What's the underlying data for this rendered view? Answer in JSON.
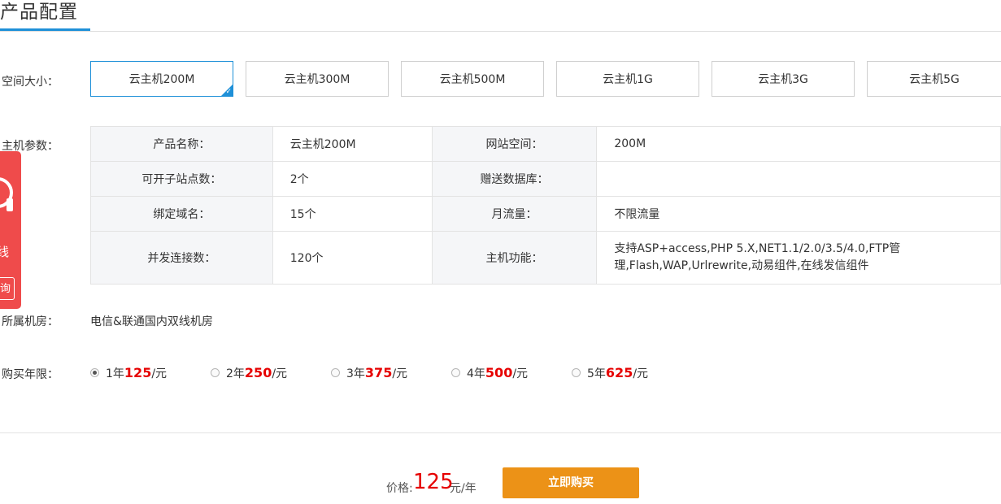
{
  "page": {
    "title": "产品配置"
  },
  "labels": {
    "space_size": "空间大小：",
    "host_params": "主机参数：",
    "room": "所属机房：",
    "period": "购买年限："
  },
  "size_options": [
    {
      "label": "云主机200M",
      "selected": true
    },
    {
      "label": "云主机300M",
      "selected": false
    },
    {
      "label": "云主机500M",
      "selected": false
    },
    {
      "label": "云主机1G",
      "selected": false
    },
    {
      "label": "云主机3G",
      "selected": false
    },
    {
      "label": "云主机5G",
      "selected": false
    }
  ],
  "params": {
    "rows": [
      {
        "k1": "产品名称：",
        "v1": "云主机200M",
        "k2": "网站空间：",
        "v2": "200M"
      },
      {
        "k1": "可开子站点数：",
        "v1": "2个",
        "k2": "赠送数据库：",
        "v2": ""
      },
      {
        "k1": "绑定域名：",
        "v1": "15个",
        "k2": "月流量：",
        "v2": "不限流量"
      },
      {
        "k1": "并发连接数：",
        "v1": "120个",
        "k2": "主机功能：",
        "v2_line1": "支持ASP+access,PHP 5.X,NET1.1/2.0/3.5/4.0,FTP管",
        "v2_line2": "理,Flash,WAP,Urlrewrite,动易组件,在线发信组件"
      }
    ]
  },
  "side_widget": {
    "text": "线",
    "button": "询"
  },
  "room": {
    "value": "电信&联通国内双线机房"
  },
  "periods": [
    {
      "years": "1年",
      "price": "125",
      "unit": "/元",
      "checked": true
    },
    {
      "years": "2年",
      "price": "250",
      "unit": "/元",
      "checked": false
    },
    {
      "years": "3年",
      "price": "375",
      "unit": "/元",
      "checked": false
    },
    {
      "years": "4年",
      "price": "500",
      "unit": "/元",
      "checked": false
    },
    {
      "years": "5年",
      "price": "625",
      "unit": "/元",
      "checked": false
    }
  ],
  "purchase": {
    "price_label": "价格:",
    "price_value": "125",
    "price_unit": "元/年",
    "buy_button": "立即购买"
  },
  "colors": {
    "accent": "#1e90d8",
    "price": "#e60000",
    "buy": "#ec9217",
    "side": "#ef4b4b"
  }
}
